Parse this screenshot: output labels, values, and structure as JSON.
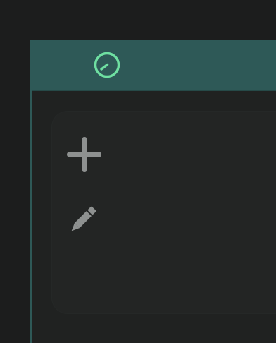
{
  "colors": {
    "background": "#1c1d1d",
    "titlebar": "#2e5957",
    "accent_logo": "#6fe0a2",
    "panel": "#232524",
    "icon": "#8e9190"
  },
  "titlebar": {
    "logo_icon": "gauge-icon"
  },
  "toolbar": {
    "items": [
      {
        "icon": "plus-icon"
      },
      {
        "icon": "pencil-icon"
      }
    ]
  }
}
